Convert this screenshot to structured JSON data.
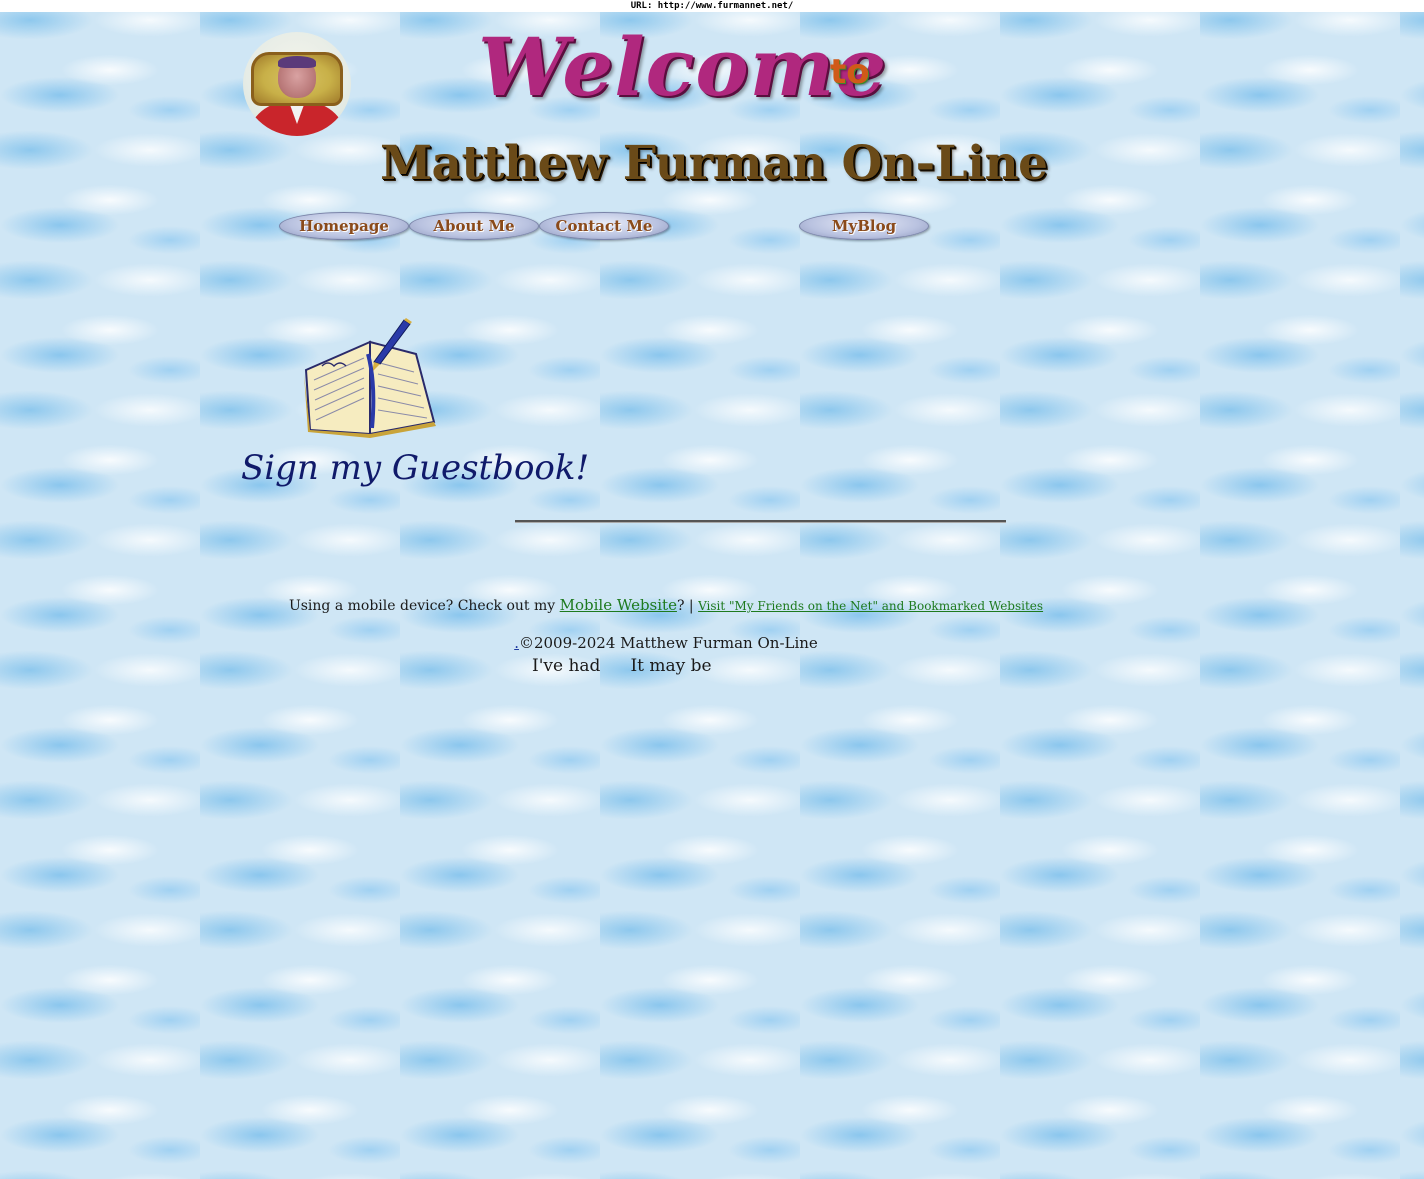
{
  "url_bar": "URL: http://www.furmannet.net/",
  "header": {
    "welcome": "Welcome",
    "to": "to",
    "site_title": "Matthew Furman On-Line"
  },
  "nav": {
    "homepage": "Homepage",
    "about": "About Me",
    "contact": "Contact Me",
    "blog": "MyBlog"
  },
  "guestbook": {
    "label": "Sign my Guestbook!"
  },
  "footer": {
    "mobile_prefix": "Using a mobile device? Check out my ",
    "mobile_link": "Mobile Website",
    "mobile_suffix": "? | ",
    "friends_link": "Visit \"My Friends on the Net\" and Bookmarked Websites",
    "copyright_link": ".",
    "copyright": "©2009-2024 Matthew Furman On-Line",
    "counter_left": "I've had",
    "counter_right": "It may be"
  }
}
